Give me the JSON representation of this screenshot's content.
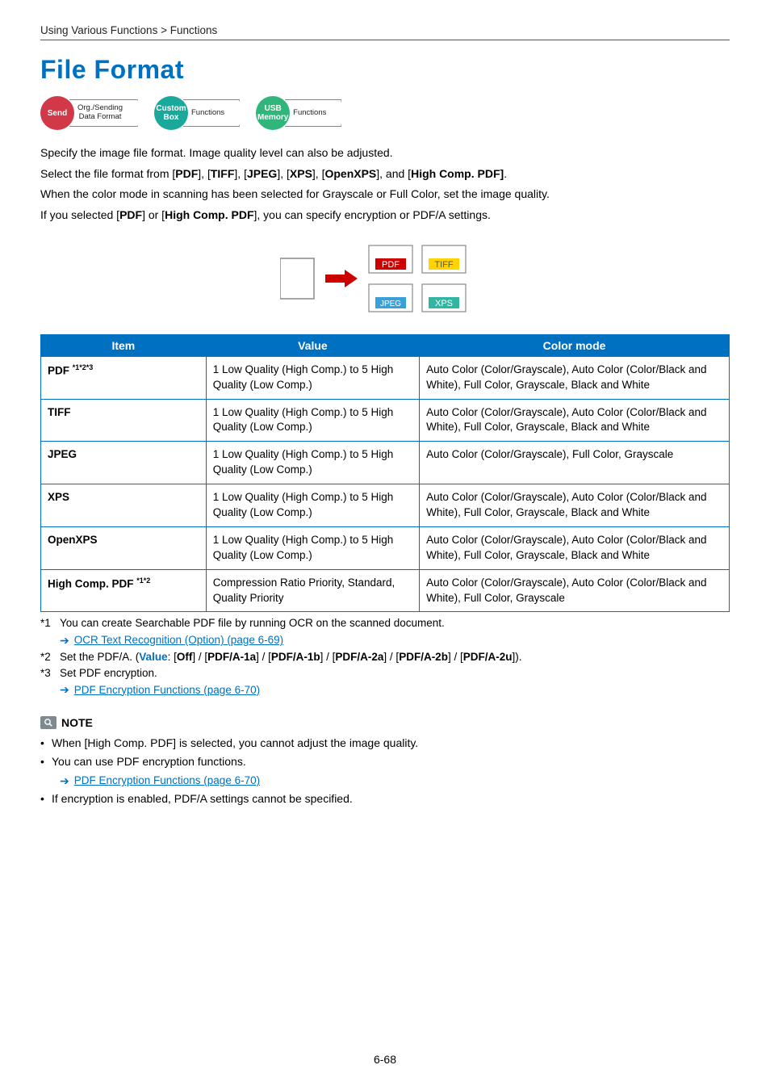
{
  "breadcrumb": "Using Various Functions > Functions",
  "heading": "File Format",
  "badges": {
    "send": {
      "label": "Send",
      "flag": "Org./Sending\nData Format"
    },
    "custom": {
      "label": "Custom\nBox",
      "flag": "Functions"
    },
    "usb": {
      "label": "USB\nMemory",
      "flag": "Functions"
    }
  },
  "intro": {
    "p1": "Specify the image file format. Image quality level can also be adjusted.",
    "p2_pre": "Select the file format from [",
    "p2_f1": "PDF",
    "p2_s1": "], [",
    "p2_f2": "TIFF",
    "p2_s2": "], [",
    "p2_f3": "JPEG",
    "p2_s3": "], [",
    "p2_f4": "XPS",
    "p2_s4": "], [",
    "p2_f5": "OpenXPS",
    "p2_s5": "], and [",
    "p2_f6": "High Comp. PDF]",
    "p2_end": ".",
    "p3": "When the color mode in scanning has been selected for Grayscale or Full Color, set the image quality.",
    "p4_pre": "If you selected [",
    "p4_f1": "PDF",
    "p4_mid": "] or [",
    "p4_f2": "High Comp. PDF",
    "p4_end": "], you can specify encryption or PDF/A settings."
  },
  "diagram": {
    "pdf": "PDF",
    "tiff": "TIFF",
    "jpeg": "JPEG",
    "xps": "XPS"
  },
  "table": {
    "headers": {
      "item": "Item",
      "value": "Value",
      "mode": "Color mode"
    },
    "rows": [
      {
        "item": "PDF ",
        "sup": "*1*2*3",
        "value": "1 Low Quality (High Comp.) to 5 High Quality (Low Comp.)",
        "mode": "Auto Color (Color/Grayscale), Auto Color (Color/Black and White), Full Color, Grayscale, Black and White"
      },
      {
        "item": "TIFF",
        "sup": "",
        "value": "1 Low Quality (High Comp.) to 5 High Quality (Low Comp.)",
        "mode": "Auto Color (Color/Grayscale), Auto Color (Color/Black and White), Full Color, Grayscale, Black and White"
      },
      {
        "item": "JPEG",
        "sup": "",
        "value": "1 Low Quality (High Comp.) to 5 High Quality (Low Comp.)",
        "mode": "Auto Color (Color/Grayscale), Full Color, Grayscale"
      },
      {
        "item": "XPS",
        "sup": "",
        "value": "1 Low Quality (High Comp.) to 5 High Quality (Low Comp.)",
        "mode": "Auto Color (Color/Grayscale), Auto Color (Color/Black and White), Full Color, Grayscale, Black and White"
      },
      {
        "item": "OpenXPS",
        "sup": "",
        "value": "1 Low Quality (High Comp.) to 5 High Quality (Low Comp.)",
        "mode": "Auto Color (Color/Grayscale), Auto Color (Color/Black and White), Full Color, Grayscale, Black and White"
      },
      {
        "item": "High Comp. PDF ",
        "sup": "*1*2",
        "value": "Compression Ratio Priority, Standard, Quality Priority",
        "mode": "Auto Color (Color/Grayscale), Auto Color (Color/Black and White), Full Color, Grayscale"
      }
    ]
  },
  "footnotes": {
    "f1": {
      "num": "*1",
      "text": "You can create Searchable PDF file by running OCR on the scanned document.",
      "link": "OCR Text Recognition (Option) (page 6-69)"
    },
    "f2": {
      "num": "*2",
      "pre": "Set the PDF/A. (",
      "value_label": "Value",
      "colon": ": [",
      "o1": "Off",
      "s1": "] / [",
      "o2": "PDF/A-1a",
      "s2": "] / [",
      "o3": "PDF/A-1b",
      "s3": "] / [",
      "o4": "PDF/A-2a",
      "s4": "] / [",
      "o5": "PDF/A-2b",
      "s5": "] / [",
      "o6": "PDF/A-2u",
      "end": "])."
    },
    "f3": {
      "num": "*3",
      "text": "Set PDF encryption.",
      "link": "PDF Encryption Functions (page 6-70)"
    }
  },
  "note": {
    "label": "NOTE",
    "b1": "When [High Comp. PDF] is selected, you cannot adjust the image quality.",
    "b2": "You can use PDF encryption functions.",
    "b2_link": "PDF Encryption Functions (page 6-70)",
    "b3": "If encryption is enabled, PDF/A settings cannot be specified."
  },
  "page_num": "6-68"
}
